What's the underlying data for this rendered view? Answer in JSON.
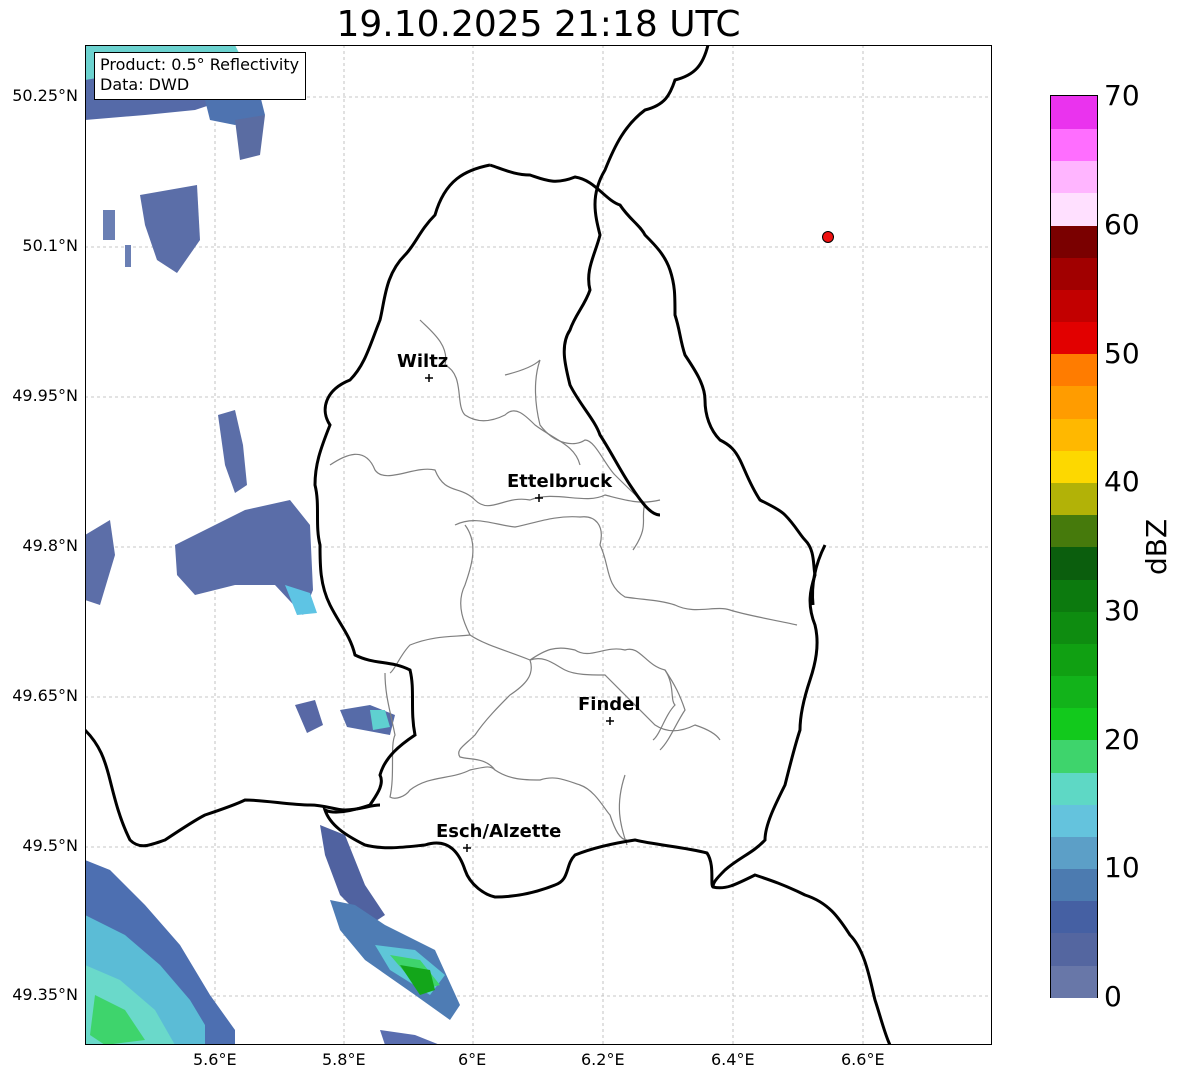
{
  "title": "19.10.2025 21:18 UTC",
  "info": {
    "line1": "Product: 0.5° Reflectivity",
    "line2": "Data: DWD"
  },
  "lat_ticks": [
    "50.25°N",
    "50.1°N",
    "49.95°N",
    "49.8°N",
    "49.65°N",
    "49.5°N",
    "49.35°N"
  ],
  "lon_ticks": [
    "5.6°E",
    "5.8°E",
    "6°E",
    "6.2°E",
    "6.4°E",
    "6.6°E"
  ],
  "cities": [
    {
      "name": "Wiltz"
    },
    {
      "name": "Ettelbruck"
    },
    {
      "name": "Findel"
    },
    {
      "name": "Esch/Alzette"
    }
  ],
  "colorbar": {
    "label": "dBZ",
    "ticks": [
      "0",
      "10",
      "20",
      "30",
      "40",
      "50",
      "60",
      "70"
    ],
    "colors": [
      "#6877a8",
      "#5466a0",
      "#4560a3",
      "#4c7bb0",
      "#5c9fc7",
      "#64c3dd",
      "#5ed8c5",
      "#3ed46c",
      "#12c91c",
      "#12b31a",
      "#10a012",
      "#0e8c10",
      "#0c7a0e",
      "#0b5e0d",
      "#467a0c",
      "#b2b207",
      "#fdd800",
      "#ffb800",
      "#ff9c00",
      "#ff7c00",
      "#e20000",
      "#c20000",
      "#a10000",
      "#7a0000",
      "#ffe0ff",
      "#ffb5ff",
      "#ff6eff",
      "#ea33ee"
    ]
  },
  "colors": {
    "border": "#000000",
    "cantons": "#7f7f7f",
    "grid": "#b0b0b0",
    "marker": "#ee1111"
  }
}
